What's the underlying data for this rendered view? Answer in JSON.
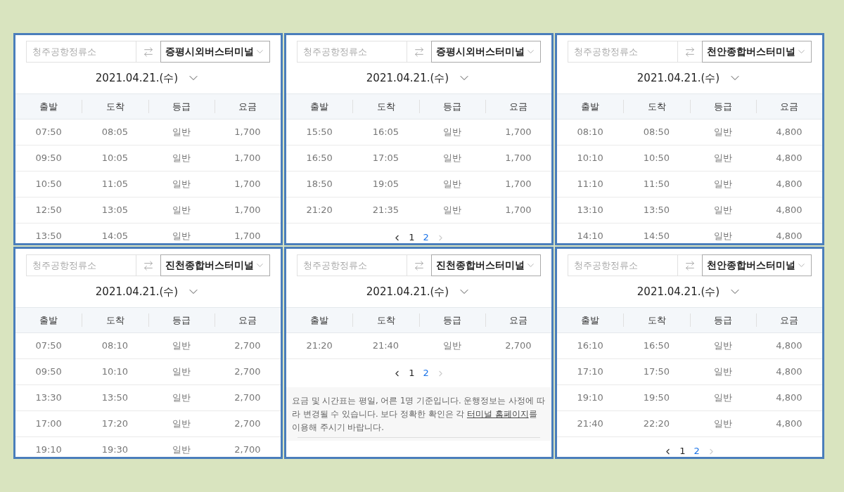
{
  "panels": [
    {
      "origin": {
        "placeholder": "청주공항정류소"
      },
      "destination": {
        "value": "증평시외버스터미널"
      },
      "date": "2021.04.21.(수)",
      "columns": [
        "출발",
        "도착",
        "등급",
        "요금"
      ],
      "rows": [
        [
          "07:50",
          "08:05",
          "일반",
          "1,700"
        ],
        [
          "09:50",
          "10:05",
          "일반",
          "1,700"
        ],
        [
          "10:50",
          "11:05",
          "일반",
          "1,700"
        ],
        [
          "12:50",
          "13:05",
          "일반",
          "1,700"
        ],
        [
          "13:50",
          "14:05",
          "일반",
          "1,700"
        ]
      ]
    },
    {
      "origin": {
        "placeholder": "청주공항정류소"
      },
      "destination": {
        "value": "증평시외버스터미널"
      },
      "date": "2021.04.21.(수)",
      "columns": [
        "출발",
        "도착",
        "등급",
        "요금"
      ],
      "rows": [
        [
          "15:50",
          "16:05",
          "일반",
          "1,700"
        ],
        [
          "16:50",
          "17:05",
          "일반",
          "1,700"
        ],
        [
          "18:50",
          "19:05",
          "일반",
          "1,700"
        ],
        [
          "21:20",
          "21:35",
          "일반",
          "1,700"
        ]
      ],
      "pagination": {
        "next_disabled": true,
        "pages": [
          {
            "label": "1",
            "selected": false
          },
          {
            "label": "2",
            "selected": true
          }
        ]
      }
    },
    {
      "origin": {
        "placeholder": "청주공항정류소"
      },
      "destination": {
        "value": "천안종합버스터미널"
      },
      "date": "2021.04.21.(수)",
      "columns": [
        "출발",
        "도착",
        "등급",
        "요금"
      ],
      "rows": [
        [
          "08:10",
          "08:50",
          "일반",
          "4,800"
        ],
        [
          "10:10",
          "10:50",
          "일반",
          "4,800"
        ],
        [
          "11:10",
          "11:50",
          "일반",
          "4,800"
        ],
        [
          "13:10",
          "13:50",
          "일반",
          "4,800"
        ],
        [
          "14:10",
          "14:50",
          "일반",
          "4,800"
        ]
      ]
    },
    {
      "origin": {
        "placeholder": "청주공항정류소"
      },
      "destination": {
        "value": "진천종합버스터미널"
      },
      "date": "2021.04.21.(수)",
      "columns": [
        "출발",
        "도착",
        "등급",
        "요금"
      ],
      "rows": [
        [
          "07:50",
          "08:10",
          "일반",
          "2,700"
        ],
        [
          "09:50",
          "10:10",
          "일반",
          "2,700"
        ],
        [
          "13:30",
          "13:50",
          "일반",
          "2,700"
        ],
        [
          "17:00",
          "17:20",
          "일반",
          "2,700"
        ],
        [
          "19:10",
          "19:30",
          "일반",
          "2,700"
        ]
      ]
    },
    {
      "origin": {
        "placeholder": "청주공항정류소"
      },
      "destination": {
        "value": "진천종합버스터미널"
      },
      "date": "2021.04.21.(수)",
      "columns": [
        "출발",
        "도착",
        "등급",
        "요금"
      ],
      "rows": [
        [
          "21:20",
          "21:40",
          "일반",
          "2,700"
        ]
      ],
      "pagination": {
        "next_disabled": true,
        "pages": [
          {
            "label": "1",
            "selected": false
          },
          {
            "label": "2",
            "selected": true
          }
        ]
      },
      "notice": {
        "text_before": "요금 및 시간표는 평일, 어른 1명 기준입니다. 운행정보는 사정에 따라 변경될 수 있습니다. 보다 정확한 확인은 각 ",
        "link": "터미널 홈페이지",
        "text_after": "를 이용해 주시기 바랍니다."
      }
    },
    {
      "origin": {
        "placeholder": "청주공항정류소"
      },
      "destination": {
        "value": "천안종합버스터미널"
      },
      "date": "2021.04.21.(수)",
      "columns": [
        "출발",
        "도착",
        "등급",
        "요금"
      ],
      "rows": [
        [
          "16:10",
          "16:50",
          "일반",
          "4,800"
        ],
        [
          "17:10",
          "17:50",
          "일반",
          "4,800"
        ],
        [
          "19:10",
          "19:50",
          "일반",
          "4,800"
        ],
        [
          "21:40",
          "22:20",
          "일반",
          "4,800"
        ]
      ],
      "pagination": {
        "next_disabled": true,
        "pages": [
          {
            "label": "1",
            "selected": false
          },
          {
            "label": "2",
            "selected": true
          }
        ]
      }
    }
  ]
}
